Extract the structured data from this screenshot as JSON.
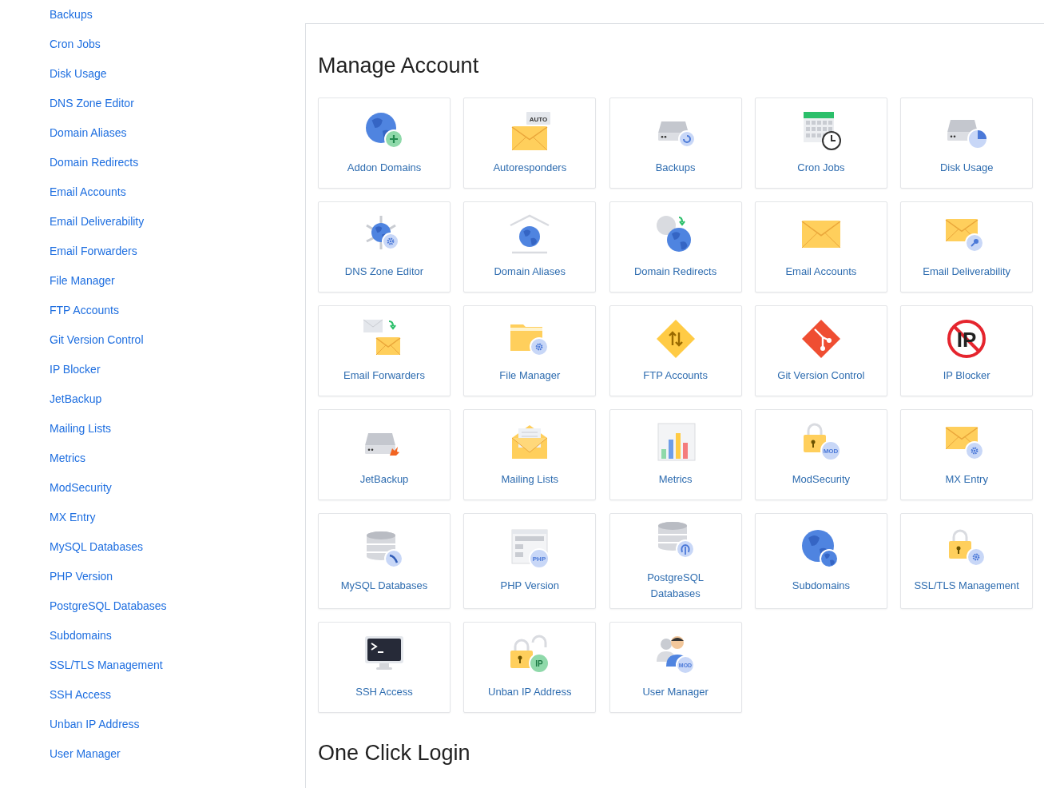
{
  "sidebar": {
    "items": [
      "Backups",
      "Cron Jobs",
      "Disk Usage",
      "DNS Zone Editor",
      "Domain Aliases",
      "Domain Redirects",
      "Email Accounts",
      "Email Deliverability",
      "Email Forwarders",
      "File Manager",
      "FTP Accounts",
      "Git Version Control",
      "IP Blocker",
      "JetBackup",
      "Mailing Lists",
      "Metrics",
      "ModSecurity",
      "MX Entry",
      "MySQL Databases",
      "PHP Version",
      "PostgreSQL Databases",
      "Subdomains",
      "SSL/TLS Management",
      "SSH Access",
      "Unban IP Address",
      "User Manager"
    ]
  },
  "sections": [
    {
      "title": "Manage Account",
      "tiles": [
        {
          "label": "Addon Domains"
        },
        {
          "label": "Autoresponders",
          "icon_text": "AUTO"
        },
        {
          "label": "Backups"
        },
        {
          "label": "Cron Jobs"
        },
        {
          "label": "Disk Usage"
        },
        {
          "label": "DNS Zone Editor"
        },
        {
          "label": "Domain Aliases"
        },
        {
          "label": "Domain Redirects"
        },
        {
          "label": "Email Accounts"
        },
        {
          "label": "Email Deliverability"
        },
        {
          "label": "Email Forwarders"
        },
        {
          "label": "File Manager"
        },
        {
          "label": "FTP Accounts"
        },
        {
          "label": "Git Version Control"
        },
        {
          "label": "IP Blocker",
          "icon_text": "IP"
        },
        {
          "label": "JetBackup"
        },
        {
          "label": "Mailing Lists"
        },
        {
          "label": "Metrics"
        },
        {
          "label": "ModSecurity",
          "icon_text": "MOD"
        },
        {
          "label": "MX Entry"
        },
        {
          "label": "MySQL Databases"
        },
        {
          "label": "PHP Version",
          "icon_text": "PHP"
        },
        {
          "label": "PostgreSQL Databases"
        },
        {
          "label": "Subdomains"
        },
        {
          "label": "SSL/TLS Management"
        },
        {
          "label": "SSH Access"
        },
        {
          "label": "Unban IP Address",
          "icon_text": "IP"
        },
        {
          "label": "User Manager",
          "icon_text": "MOD"
        }
      ]
    },
    {
      "title": "One Click Login"
    }
  ]
}
